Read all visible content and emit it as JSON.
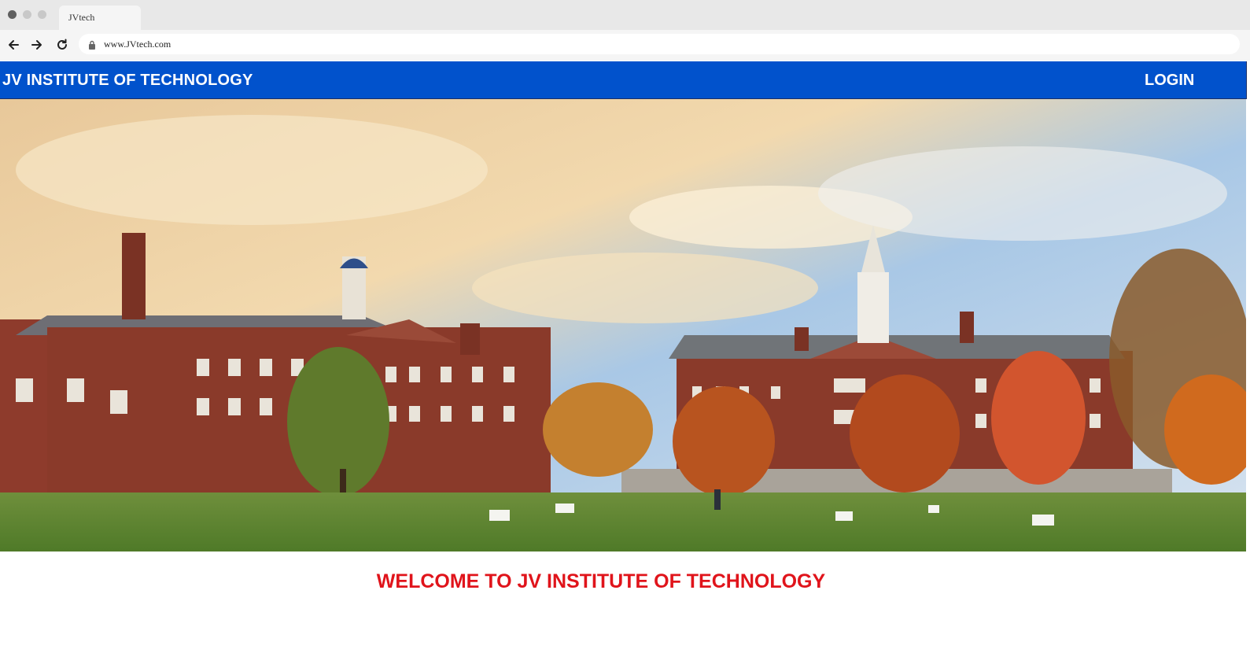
{
  "browser": {
    "tab_title": "JVtech",
    "url": "www.JVtech.com",
    "window_controls": [
      "close-dot",
      "minimize-dot",
      "maximize-dot"
    ],
    "nav_icons": [
      "back-arrow-icon",
      "forward-arrow-icon",
      "reload-icon",
      "lock-icon"
    ]
  },
  "navbar": {
    "brand": "JV INSTITUTE OF TECHNOLOGY",
    "login_label": "LOGIN",
    "background_color": "#0152cc",
    "text_color": "#ffffff"
  },
  "hero": {
    "image_subject": "campus-buildings-photo"
  },
  "main": {
    "welcome": "WELCOME TO JV INSTITUTE OF TECHNOLOGY",
    "welcome_color": "#e0141b"
  }
}
